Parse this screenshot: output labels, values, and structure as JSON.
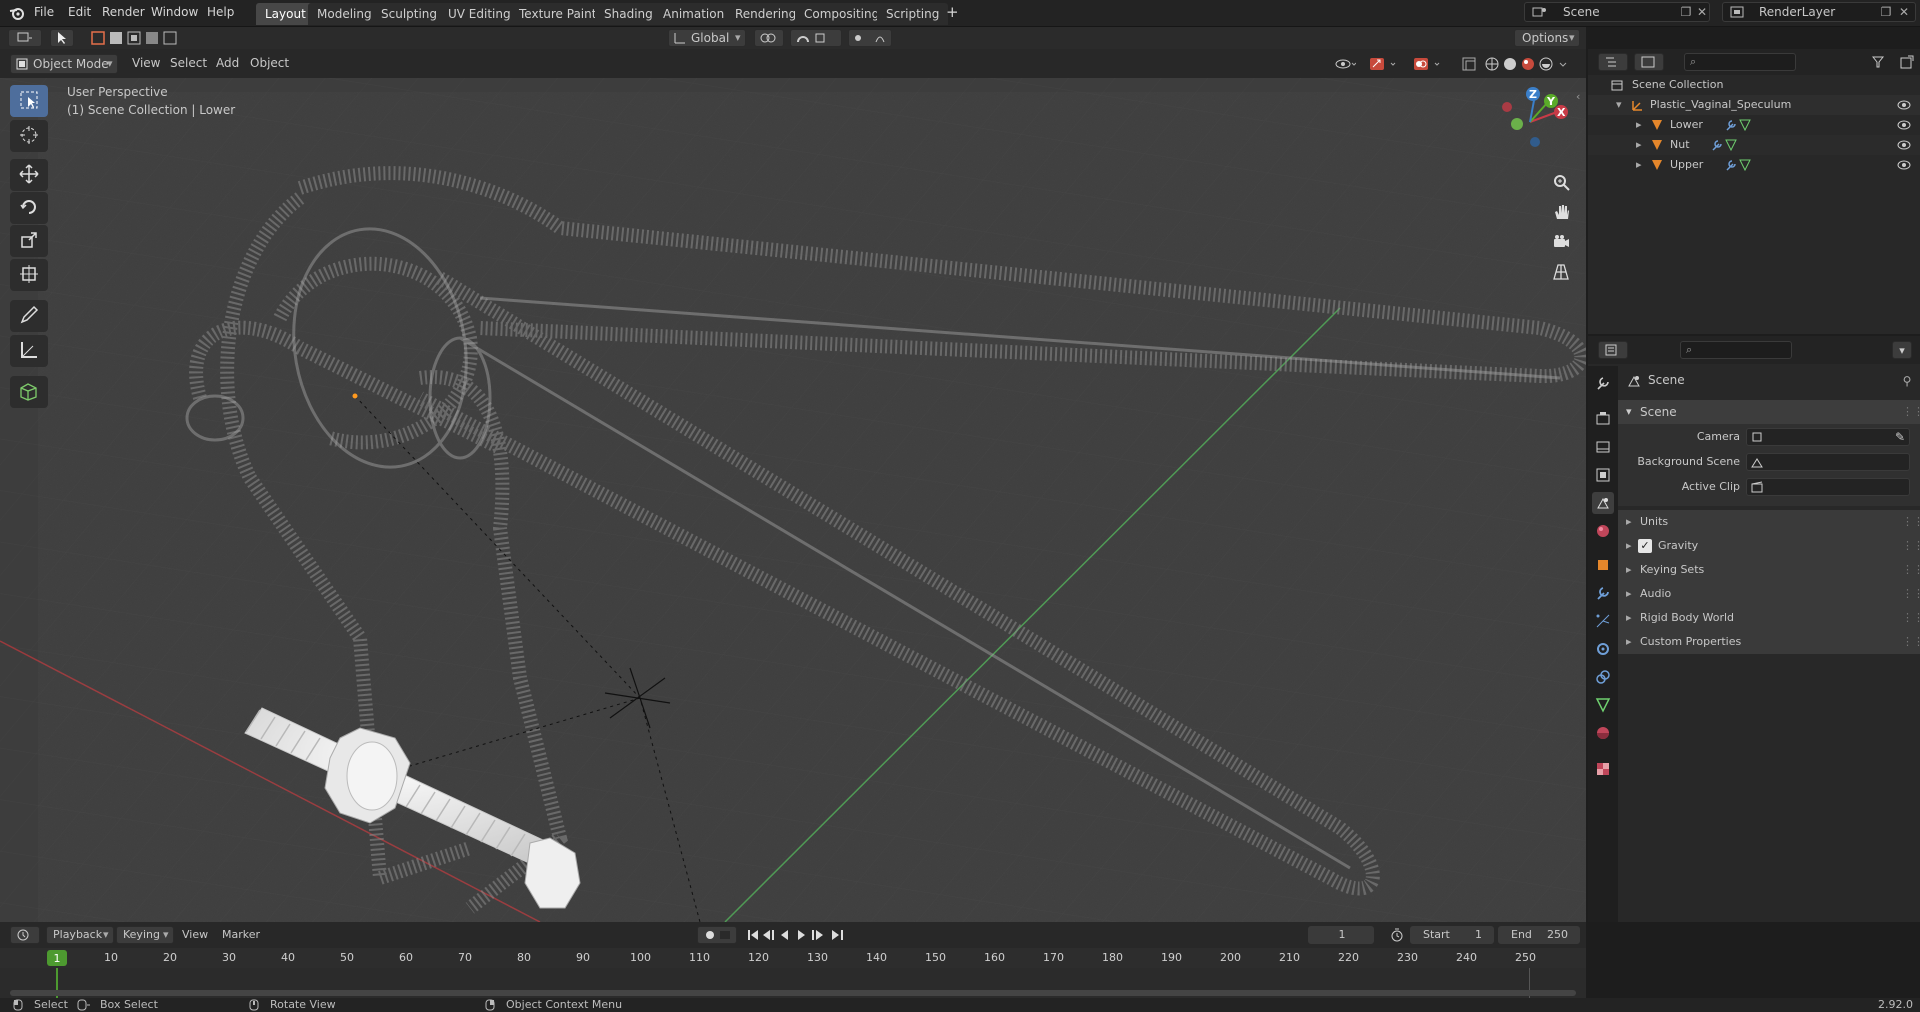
{
  "topbar": {
    "menus": [
      "File",
      "Edit",
      "Render",
      "Window",
      "Help"
    ],
    "workspaces": [
      "Layout",
      "Modeling",
      "Sculpting",
      "UV Editing",
      "Texture Paint",
      "Shading",
      "Animation",
      "Rendering",
      "Compositing",
      "Scripting"
    ],
    "active_workspace": "Layout",
    "add_tab": "+",
    "scene_name": "Scene",
    "view_layer": "RenderLayer"
  },
  "viewport_header": {
    "mode": "Object Mode",
    "menus": [
      "View",
      "Select",
      "Add",
      "Object"
    ],
    "transform_orientation": "Global",
    "options": "Options"
  },
  "viewport": {
    "view_name": "User Perspective",
    "context": "(1) Scene Collection | Lower"
  },
  "gizmo": {
    "x": "X",
    "y": "Y",
    "z": "Z"
  },
  "outliner": {
    "root": "Scene Collection",
    "collection": "Plastic_Vaginal_Speculum",
    "objects": [
      {
        "name": "Lower"
      },
      {
        "name": "Nut"
      },
      {
        "name": "Upper"
      }
    ]
  },
  "properties": {
    "context": "Scene",
    "panel": "Scene",
    "fields": {
      "camera": "Camera",
      "background_scene": "Background Scene",
      "active_clip": "Active Clip"
    },
    "subpanels": [
      "Units",
      "Gravity",
      "Keying Sets",
      "Audio",
      "Rigid Body World",
      "Custom Properties"
    ],
    "gravity_checked": true
  },
  "timeline": {
    "menus": [
      "Playback",
      "Keying",
      "View",
      "Marker"
    ],
    "current_frame": "1",
    "start_label": "Start",
    "start": "1",
    "end_label": "End",
    "end": "250",
    "frame_ticks": [
      "10",
      "20",
      "30",
      "40",
      "50",
      "60",
      "70",
      "80",
      "90",
      "100",
      "110",
      "120",
      "130",
      "140",
      "150",
      "160",
      "170",
      "180",
      "190",
      "200",
      "210",
      "220",
      "230",
      "240",
      "250"
    ],
    "frame_marker": "1"
  },
  "statusbar": {
    "items": [
      "Select",
      "Box Select",
      "Rotate View",
      "Object Context Menu"
    ],
    "version": "2.92.0"
  },
  "colors": {
    "accent": "#4e6e9c",
    "object_orange": "#e5872b",
    "x_axis": "#c83b47",
    "y_axis": "#5aab29",
    "z_axis": "#3b7fc9",
    "green_frame": "#4d9a30"
  }
}
